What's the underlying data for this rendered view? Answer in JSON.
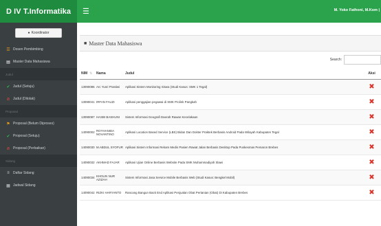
{
  "topbar": {
    "brand": "D IV T.Informatika",
    "menu_icon": "hamburger-icon",
    "user": "M. Yoko Fathoni, M.Kom |"
  },
  "sidebar": {
    "button_label": "Koordinator",
    "sections": [
      {
        "type": "item",
        "label": "Dosen Pembimbing",
        "icon": "users-icon",
        "color": "#f0a020"
      },
      {
        "type": "item",
        "label": "Master Data Mahasiswa",
        "icon": "file-icon",
        "color": "#ffffff"
      },
      {
        "type": "header",
        "label": "Judul"
      },
      {
        "type": "item",
        "label": "Judul (Setuju)",
        "icon": "check-icon",
        "color": "#2fbf4f"
      },
      {
        "type": "item",
        "label": "Judul (Ditolak)",
        "icon": "ban-icon",
        "color": "#e04b3c"
      },
      {
        "type": "header",
        "label": "Proposal"
      },
      {
        "type": "item",
        "label": "Proposal (Belum Diproses)",
        "icon": "flag-icon",
        "color": "#f0a020"
      },
      {
        "type": "item",
        "label": "Proposal (Setuju)",
        "icon": "check-icon",
        "color": "#2fbf4f"
      },
      {
        "type": "item",
        "label": "Proposal (Perbaikan)",
        "icon": "ban-icon",
        "color": "#e04b3c"
      },
      {
        "type": "header",
        "label": "Sidang"
      },
      {
        "type": "item",
        "label": "Daftar Sidang",
        "icon": "list-icon",
        "color": "#cfd6d8"
      },
      {
        "type": "item",
        "label": "Jadwal Sidang",
        "icon": "calendar-icon",
        "color": "#cfd6d8"
      }
    ]
  },
  "panel": {
    "title": "Master Data Mahasiswa",
    "search_label": "Search:",
    "search_value": ""
  },
  "table": {
    "headers": {
      "nim": "NIM",
      "nama": "Nama",
      "judul": "Judul",
      "aksi": "Aksi"
    },
    "rows": [
      {
        "nim": "13090086",
        "nama": "Arc Yusri Prastiwi",
        "judul": "Aplikasi Sistem Monitoring Siswa (Studi Kasus: SMK 1 Tegal)"
      },
      {
        "nim": "13090041",
        "nama": "IRFAN FAUZI",
        "judul": "Aplikasi penggajian pegawai di SMK Prolink Pangkah"
      },
      {
        "nim": "13090087",
        "nama": "HASBI BASHUNI",
        "judul": "Sistem Informasi Geografi Daerah Rawan Kecelakaan"
      },
      {
        "nim": "14090002",
        "nama": "ROYHANIDA NOVANTINO",
        "judul": "Aplikasi Location Based Service (LBS) Bidan Dan Dokter Praktek Berbasis Android Pada Wilayah Kabupaten Tegal"
      },
      {
        "nim": "14090030",
        "nama": "M.ABDUL SYOFUR",
        "judul": "Aplikasi Sistem Informasi Rekam Medis Pasien Rawat Jalan Berbasis Desktop Pada Puskesmas Pemaron Brebes"
      },
      {
        "nim": "14090032",
        "nama": "AKHMAD FAJAR",
        "judul": "Aplikasi Ujian Online Berbasis Website Pada SMK Muhammadiyah Slawi"
      },
      {
        "nim": "14090034",
        "nama": "KHOLIN NUR AZIZAH",
        "judul": "Sistem Informasi Jasa Service Mobile Berbasis Web (Studi Kasus: Bengkel Mobil)"
      },
      {
        "nim": "14090042",
        "nama": "RIZKI HARYANTO",
        "judul": "Rancang Bangun Back End Aplikasi Penjualan Obat Pertanian (Obat) Di Kabupaten Brebes"
      }
    ]
  },
  "colors": {
    "topbar": "#2aa34c",
    "brand_bg": "#1f8b3f",
    "sidebar": "#3a3f42",
    "delete": "#d9362c"
  }
}
